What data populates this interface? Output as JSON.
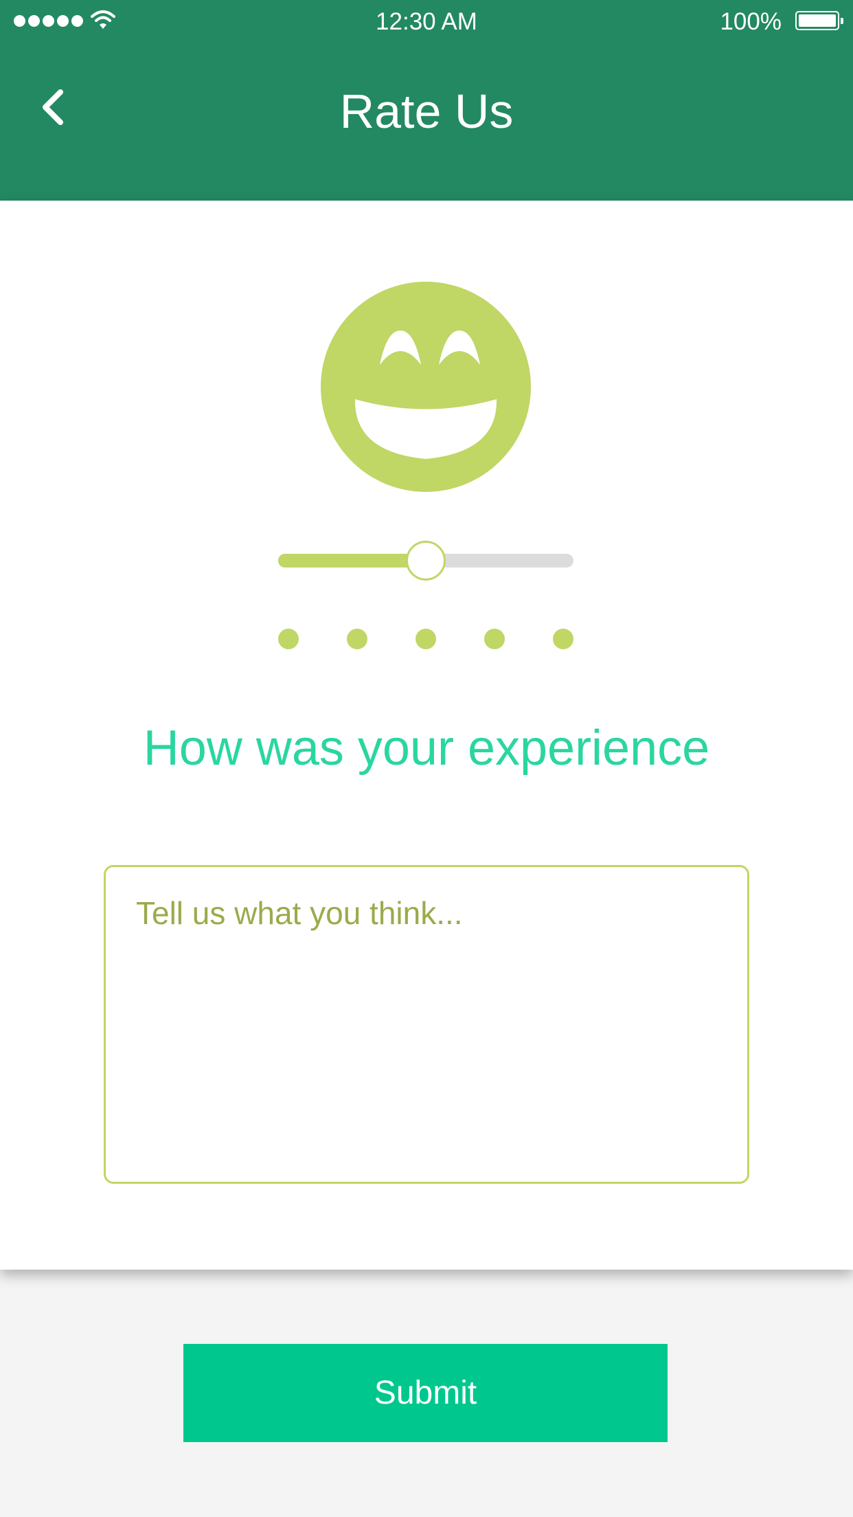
{
  "status_bar": {
    "time": "12:30 AM",
    "battery": "100%"
  },
  "header": {
    "title": "Rate Us"
  },
  "icons": {
    "back": "chevron-left-icon",
    "face": "grinning-smiley-icon",
    "signal": "signal-dots-icon",
    "wifi": "wifi-icon",
    "battery": "battery-icon"
  },
  "rating": {
    "slider_value": 0.5,
    "levels": 5
  },
  "question": "How was your experience",
  "feedback": {
    "placeholder": "Tell us what you think...",
    "value": ""
  },
  "submit_label": "Submit",
  "colors": {
    "header": "#238962",
    "accent": "#c0d665",
    "question": "#2ad6a0",
    "button": "#00c78d",
    "track": "#dcdcdc"
  }
}
